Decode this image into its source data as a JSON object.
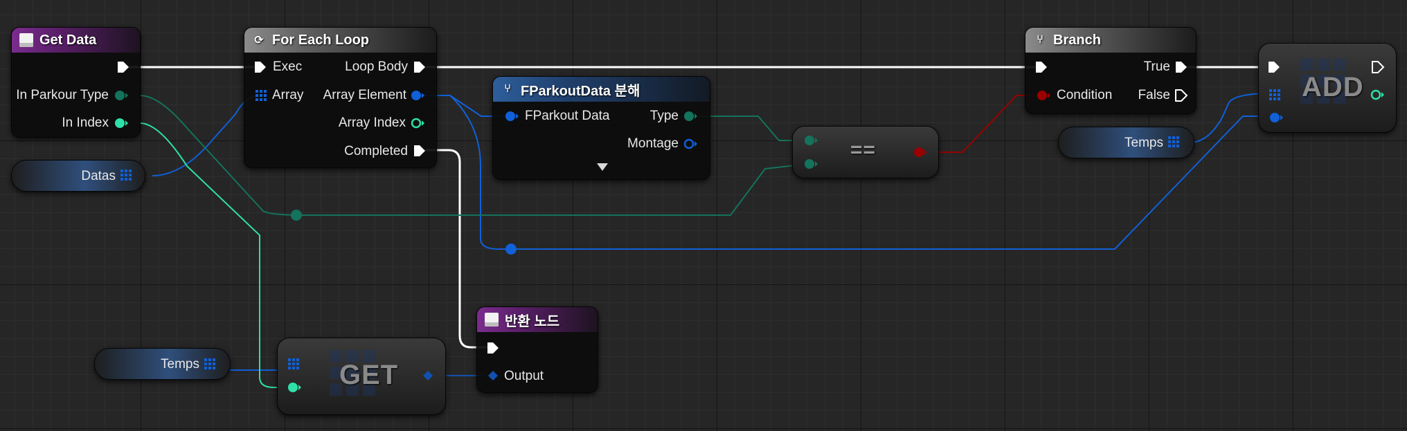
{
  "colors": {
    "exec": "#ffffff",
    "byte_pin": "#14735c",
    "int_pin": "#2fe0a8",
    "struct_pin": "#1060d8",
    "bool_pin": "#9a0000",
    "array_pin": "#1060d8",
    "wildcard_pin": "#1050b0"
  },
  "nodes": {
    "get_data": {
      "title": "Get Data",
      "icon": "function-icon",
      "inputs": [
        "In Parkour Type",
        "In Index"
      ]
    },
    "for_each": {
      "title": "For Each Loop",
      "icon": "loop-icon",
      "inputs": [
        "Exec",
        "Array"
      ],
      "outputs": [
        "Loop Body",
        "Array Element",
        "Array Index",
        "Completed"
      ]
    },
    "break_struct": {
      "title": "FParkoutData 분해",
      "icon": "break-struct-icon",
      "inputs": [
        "FParkout Data"
      ],
      "outputs": [
        "Type",
        "Montage"
      ]
    },
    "equal": {
      "label": "=="
    },
    "branch": {
      "title": "Branch",
      "icon": "branch-icon",
      "inputs": [
        "Condition"
      ],
      "outputs": [
        "True",
        "False"
      ]
    },
    "add": {
      "label": "ADD"
    },
    "return_node": {
      "title": "반환 노드",
      "icon": "function-icon",
      "outputs": [
        "Output"
      ]
    },
    "get": {
      "label": "GET"
    }
  },
  "variables": {
    "datas": "Datas",
    "temps_add": "Temps",
    "temps_get": "Temps"
  }
}
